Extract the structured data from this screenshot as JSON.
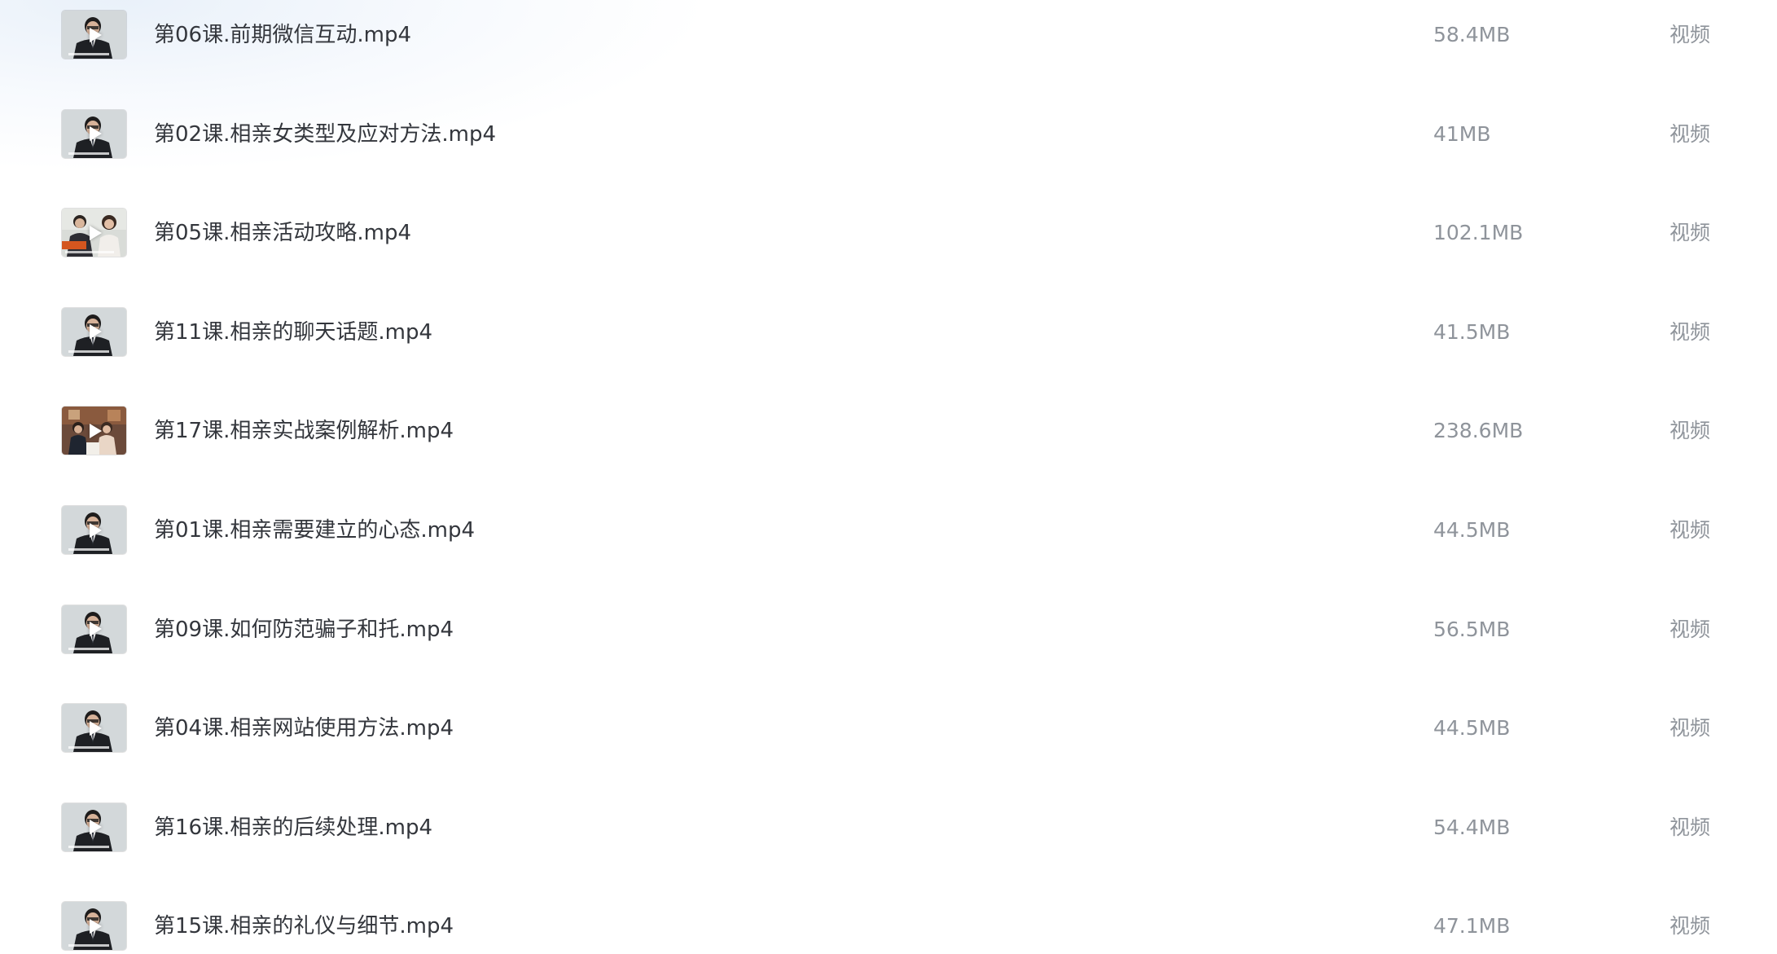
{
  "files": [
    {
      "name": "第06课.前期微信互动.mp4",
      "size": "58.4MB",
      "type": "视频",
      "thumb_icon": "video-thumbnail-man-suit",
      "thumb_bg": "#c9cfd1"
    },
    {
      "name": "第02课.相亲女类型及应对方法.mp4",
      "size": "41MB",
      "type": "视频",
      "thumb_icon": "video-thumbnail-man-suit",
      "thumb_bg": "#c9cfd1"
    },
    {
      "name": "第05课.相亲活动攻略.mp4",
      "size": "102.1MB",
      "type": "视频",
      "thumb_icon": "video-thumbnail-two-people",
      "thumb_bg": "#d9dcd8"
    },
    {
      "name": "第11课.相亲的聊天话题.mp4",
      "size": "41.5MB",
      "type": "视频",
      "thumb_icon": "video-thumbnail-man-suit",
      "thumb_bg": "#c9cfd1"
    },
    {
      "name": "第17课.相亲实战案例解析.mp4",
      "size": "238.6MB",
      "type": "视频",
      "thumb_icon": "video-thumbnail-cafe-scene",
      "thumb_bg": "#6b4a3a"
    },
    {
      "name": "第01课.相亲需要建立的心态.mp4",
      "size": "44.5MB",
      "type": "视频",
      "thumb_icon": "video-thumbnail-man-suit",
      "thumb_bg": "#c9cfd1"
    },
    {
      "name": "第09课.如何防范骗子和托.mp4",
      "size": "56.5MB",
      "type": "视频",
      "thumb_icon": "video-thumbnail-man-suit",
      "thumb_bg": "#c9cfd1"
    },
    {
      "name": "第04课.相亲网站使用方法.mp4",
      "size": "44.5MB",
      "type": "视频",
      "thumb_icon": "video-thumbnail-man-suit",
      "thumb_bg": "#c9cfd1"
    },
    {
      "name": "第16课.相亲的后续处理.mp4",
      "size": "54.4MB",
      "type": "视频",
      "thumb_icon": "video-thumbnail-man-suit",
      "thumb_bg": "#c9cfd1"
    },
    {
      "name": "第15课.相亲的礼仪与细节.mp4",
      "size": "47.1MB",
      "type": "视频",
      "thumb_icon": "video-thumbnail-man-suit",
      "thumb_bg": "#c9cfd1"
    }
  ]
}
